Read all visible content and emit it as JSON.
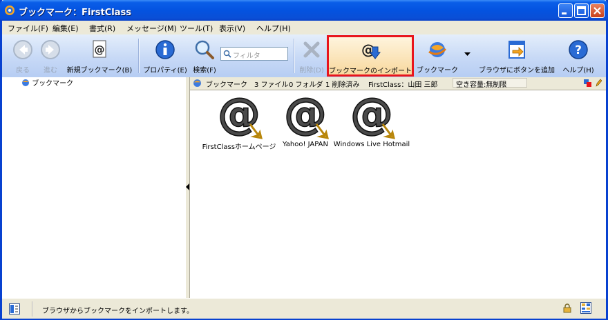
{
  "window": {
    "title": "ブックマーク：FirstClass"
  },
  "menu": [
    "ファイル(F)",
    "編集(E)",
    "書式(R)",
    "メッセージ(M)",
    "ツール(T)",
    "表示(V)",
    "ヘルプ(H)"
  ],
  "toolbar": {
    "back": "戻る",
    "forward": "進む",
    "new_bookmark": "新規ブックマーク(B)",
    "properties": "プロパティ(E)",
    "search": "検索(F)",
    "filter_placeholder": "フィルタ",
    "delete": "削除(D)",
    "import": "ブックマークのインポート",
    "bookmark": "ブックマーク",
    "add_browser_button": "ブラウザにボタンを追加",
    "help": "ヘルプ(H)"
  },
  "tree": {
    "root": "ブックマーク"
  },
  "info": {
    "name": "ブックマーク",
    "files": "3 ファイル",
    "folders": "0 フォルダ",
    "deleted": "1 削除済み",
    "user": "FirstClass：山田 三郎",
    "space": "空き容量:無制限"
  },
  "items": [
    {
      "label": "FirstClassホームページ"
    },
    {
      "label": "Yahoo! JAPAN"
    },
    {
      "label": "Windows Live Hotmail"
    }
  ],
  "status": {
    "text": "ブラウザからブックマークをインポートします。"
  },
  "colors": {
    "import_highlight": "#E8141C",
    "title_bar": "#0453E0"
  }
}
